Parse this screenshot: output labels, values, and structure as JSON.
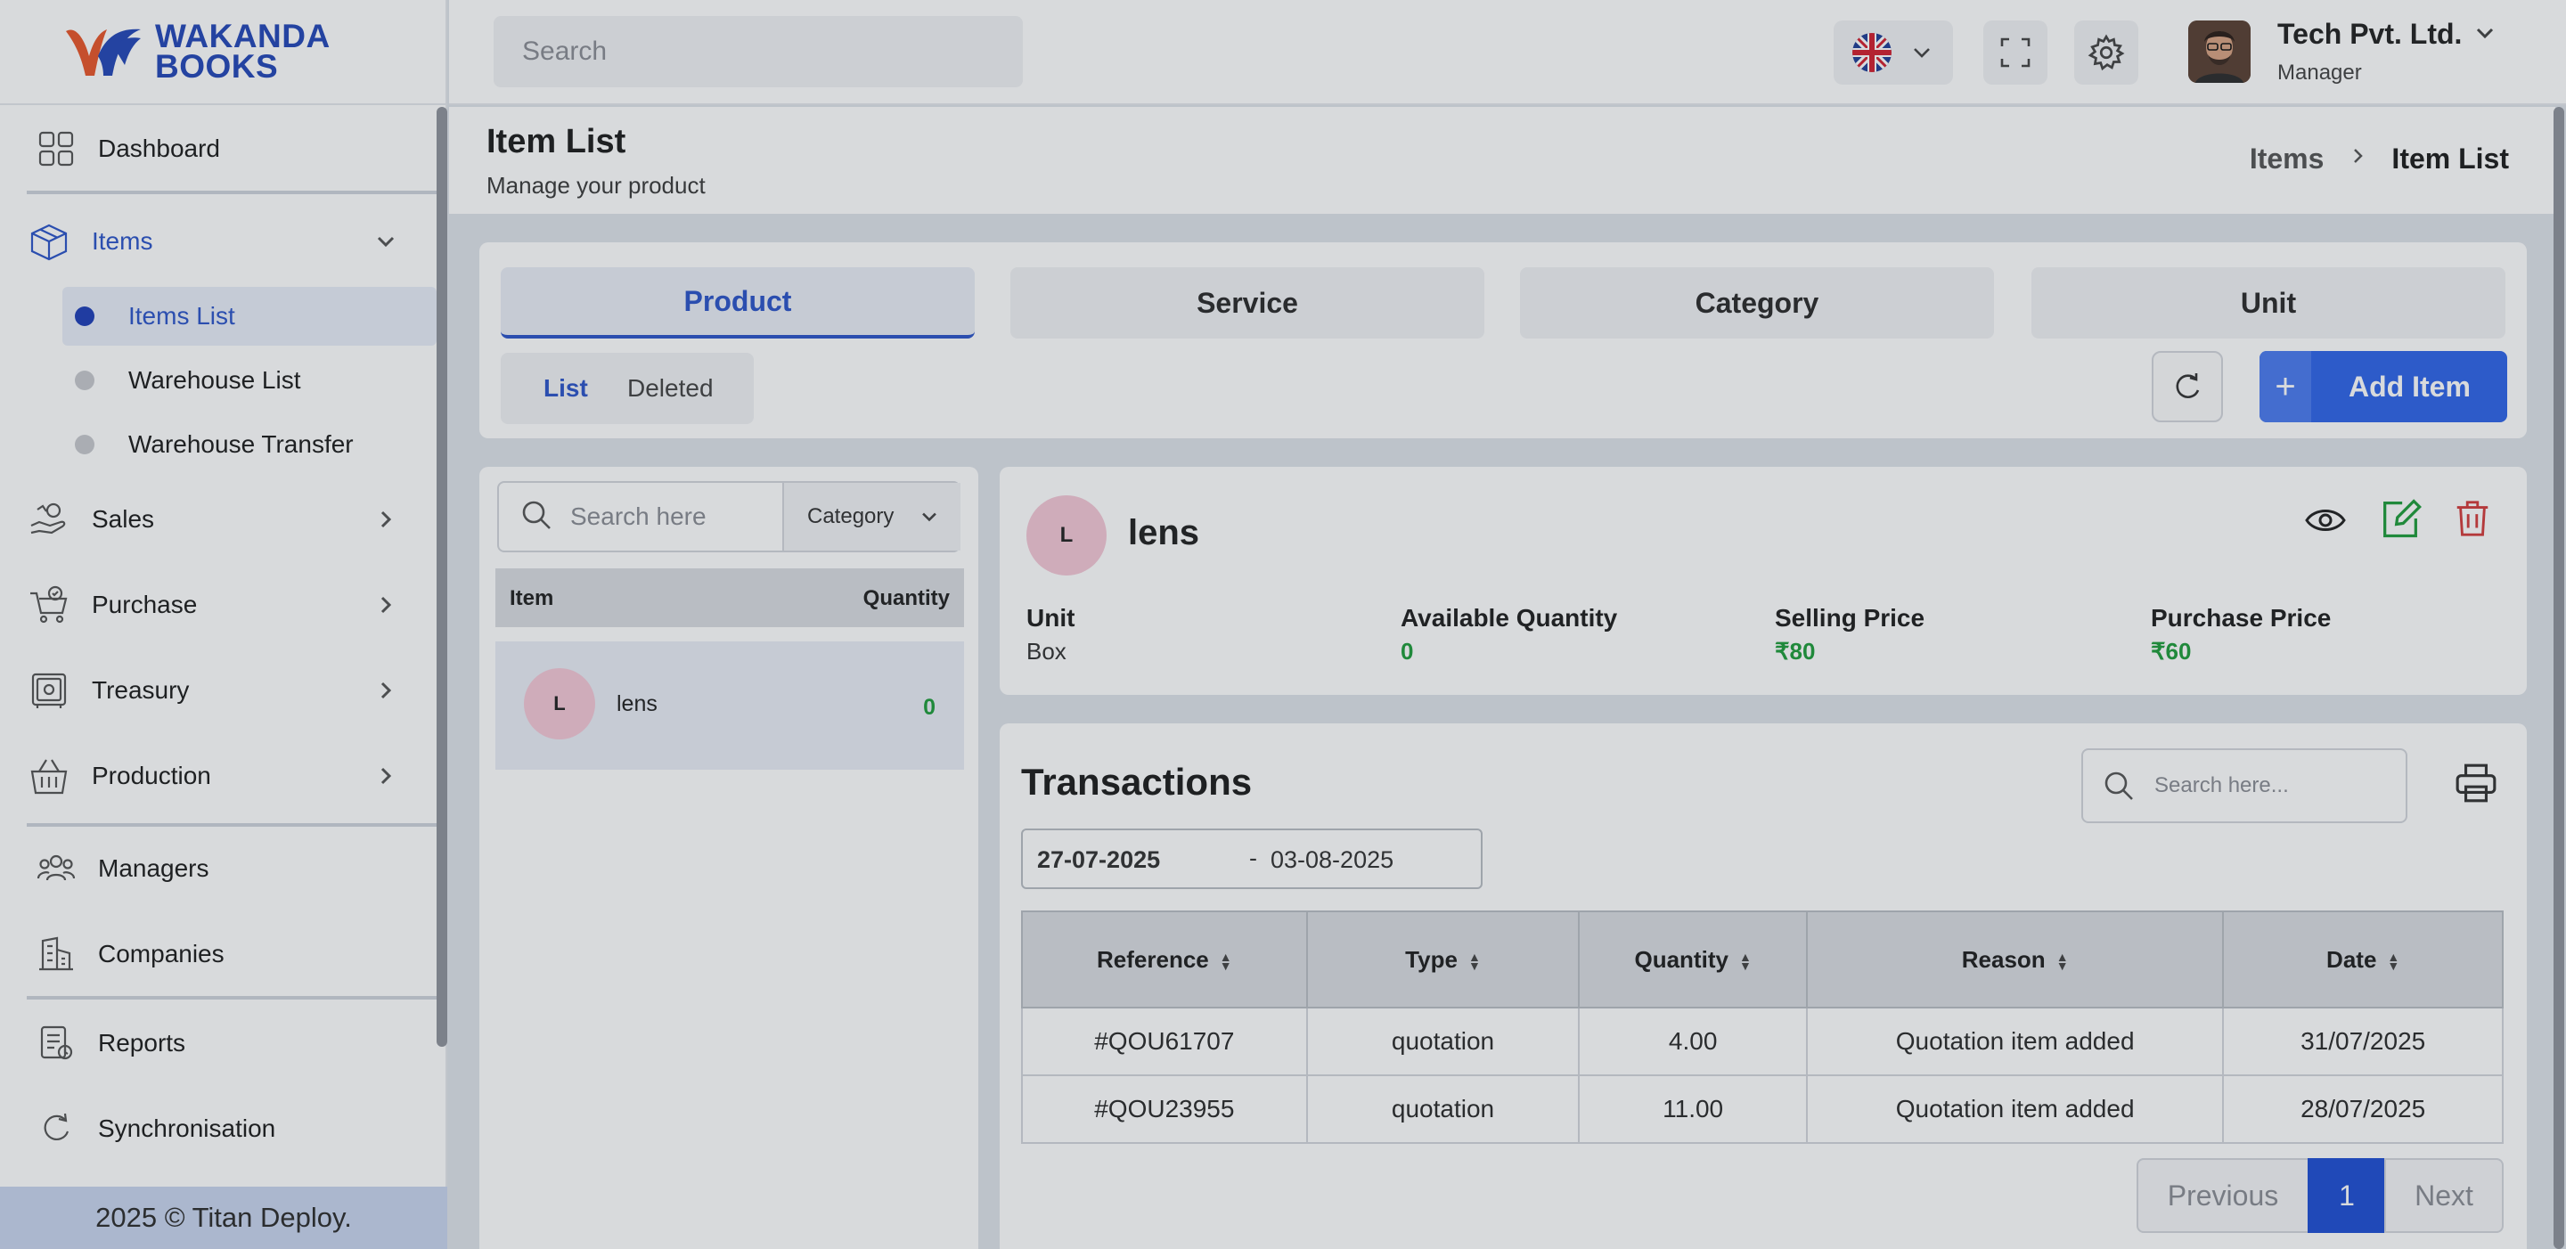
{
  "brand": {
    "line1": "WAKANDA",
    "line2": "BOOKS"
  },
  "sidebar": {
    "dashboard": "Dashboard",
    "items": "Items",
    "sub_items": [
      "Items List",
      "Warehouse List",
      "Warehouse Transfer"
    ],
    "sales": "Sales",
    "purchase": "Purchase",
    "treasury": "Treasury",
    "production": "Production",
    "managers": "Managers",
    "companies": "Companies",
    "reports": "Reports",
    "synchronisation": "Synchronisation",
    "footer": "2025 © Titan Deploy."
  },
  "topbar": {
    "search_placeholder": "Search",
    "company": "Tech Pvt. Ltd.",
    "role": "Manager"
  },
  "page": {
    "title": "Item List",
    "subtitle": "Manage your product",
    "breadcrumb": [
      "Items",
      "Item List"
    ]
  },
  "tabs": [
    "Product",
    "Service",
    "Category",
    "Unit"
  ],
  "toggle": {
    "list": "List",
    "deleted": "Deleted"
  },
  "add_item_label": "Add Item",
  "item_list": {
    "search_placeholder": "Search here",
    "category_label": "Category",
    "col_item": "Item",
    "col_quantity": "Quantity",
    "rows": [
      {
        "initial": "L",
        "name": "lens",
        "quantity": "0"
      }
    ]
  },
  "detail": {
    "initial": "L",
    "name": "lens",
    "unit_label": "Unit",
    "unit_value": "Box",
    "avail_label": "Available Quantity",
    "avail_value": "0",
    "selling_label": "Selling Price",
    "selling_value": "₹80",
    "purchase_label": "Purchase Price",
    "purchase_value": "₹60"
  },
  "transactions": {
    "title": "Transactions",
    "search_placeholder": "Search here...",
    "date_from": "27-07-2025",
    "date_sep": "-",
    "date_to": "03-08-2025",
    "columns": [
      "Reference",
      "Type",
      "Quantity",
      "Reason",
      "Date"
    ],
    "rows": [
      [
        "#QOU61707",
        "quotation",
        "4.00",
        "Quotation item added",
        "31/07/2025"
      ],
      [
        "#QOU23955",
        "quotation",
        "11.00",
        "Quotation item added",
        "28/07/2025"
      ]
    ],
    "prev_label": "Previous",
    "page": "1",
    "next_label": "Next"
  },
  "colors": {
    "accent": "#2c55c9",
    "success": "#1f9d3b",
    "danger": "#d33b3b",
    "logo_orange": "#e8562a"
  }
}
